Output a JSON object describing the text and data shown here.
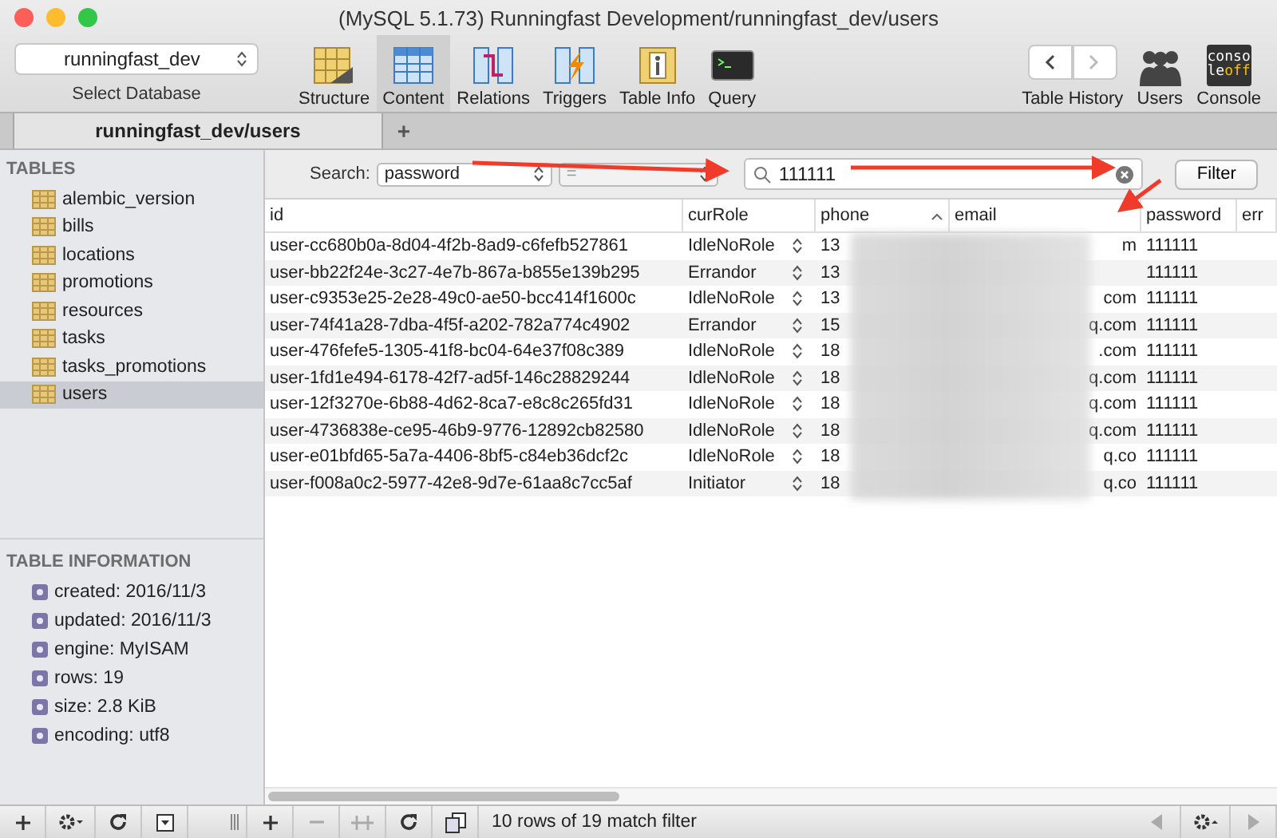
{
  "window": {
    "title": "(MySQL 5.1.73) Runningfast Development/runningfast_dev/users"
  },
  "toolbar": {
    "database": {
      "value": "runningfast_dev",
      "label": "Select Database"
    },
    "views": [
      {
        "kind": "structure",
        "label": "Structure",
        "selected": false
      },
      {
        "kind": "content",
        "label": "Content",
        "selected": true
      },
      {
        "kind": "relations",
        "label": "Relations",
        "selected": false
      },
      {
        "kind": "triggers",
        "label": "Triggers",
        "selected": false
      },
      {
        "kind": "info",
        "label": "Table Info",
        "selected": false
      },
      {
        "kind": "query",
        "label": "Query",
        "selected": false
      }
    ],
    "history_label": "Table History",
    "users_label": "Users",
    "console": {
      "label": "Console",
      "icon_top": "conso",
      "icon_bottom_left": "le",
      "icon_bottom_right": "off"
    }
  },
  "tabs": [
    {
      "label": "runningfast_dev/users",
      "selected": true
    }
  ],
  "add_tab": "+",
  "sidebar": {
    "tables_heading": "TABLES",
    "tables": [
      {
        "name": "alembic_version",
        "selected": false
      },
      {
        "name": "bills",
        "selected": false
      },
      {
        "name": "locations",
        "selected": false
      },
      {
        "name": "promotions",
        "selected": false
      },
      {
        "name": "resources",
        "selected": false
      },
      {
        "name": "tasks",
        "selected": false
      },
      {
        "name": "tasks_promotions",
        "selected": false
      },
      {
        "name": "users",
        "selected": true
      }
    ],
    "info_heading": "TABLE INFORMATION",
    "info": [
      "created: 2016/11/3",
      "updated: 2016/11/3",
      "engine: MyISAM",
      "rows: 19",
      "size: 2.8 KiB",
      "encoding: utf8"
    ]
  },
  "filter": {
    "label": "Search:",
    "field": "password",
    "operator": "=",
    "value": "111111",
    "button": "Filter"
  },
  "table": {
    "columns": [
      {
        "name": "id",
        "sorted": false
      },
      {
        "name": "curRole",
        "sorted": false
      },
      {
        "name": "phone",
        "sorted": true
      },
      {
        "name": "email",
        "sorted": false
      },
      {
        "name": "password",
        "sorted": false
      },
      {
        "name": "err",
        "sorted": false
      }
    ],
    "rows": [
      [
        "user-cc680b0a-8d04-4f2b-8ad9-c6fefb527861",
        "IdleNoRole",
        "13",
        "m",
        "111111"
      ],
      [
        "user-bb22f24e-3c27-4e7b-867a-b855e139b295",
        "Errandor",
        "13",
        "",
        "111111"
      ],
      [
        "user-c9353e25-2e28-49c0-ae50-bcc414f1600c",
        "IdleNoRole",
        "13",
        "com",
        "111111"
      ],
      [
        "user-74f41a28-7dba-4f5f-a202-782a774c4902",
        "Errandor",
        "15",
        "q.com",
        "111111"
      ],
      [
        "user-476fefe5-1305-41f8-bc04-64e37f08c389",
        "IdleNoRole",
        "18",
        ".com",
        "111111"
      ],
      [
        "user-1fd1e494-6178-42f7-ad5f-146c28829244",
        "IdleNoRole",
        "18",
        "q.com",
        "111111"
      ],
      [
        "user-12f3270e-6b88-4d62-8ca7-e8c8c265fd31",
        "IdleNoRole",
        "18",
        "q.com",
        "111111"
      ],
      [
        "user-4736838e-ce95-46b9-9776-12892cb82580",
        "IdleNoRole",
        "18",
        "q.com",
        "111111"
      ],
      [
        "user-e01bfd65-5a7a-4406-8bf5-c84eb36dcf2c",
        "IdleNoRole",
        "18",
        "q.co",
        "111111"
      ],
      [
        "user-f008a0c2-5977-42e8-9d7e-61aa8c7cc5af",
        "Initiator",
        "18",
        "q.co",
        "111111"
      ]
    ]
  },
  "status_bar": {
    "text": "10 rows of 19 match filter"
  }
}
